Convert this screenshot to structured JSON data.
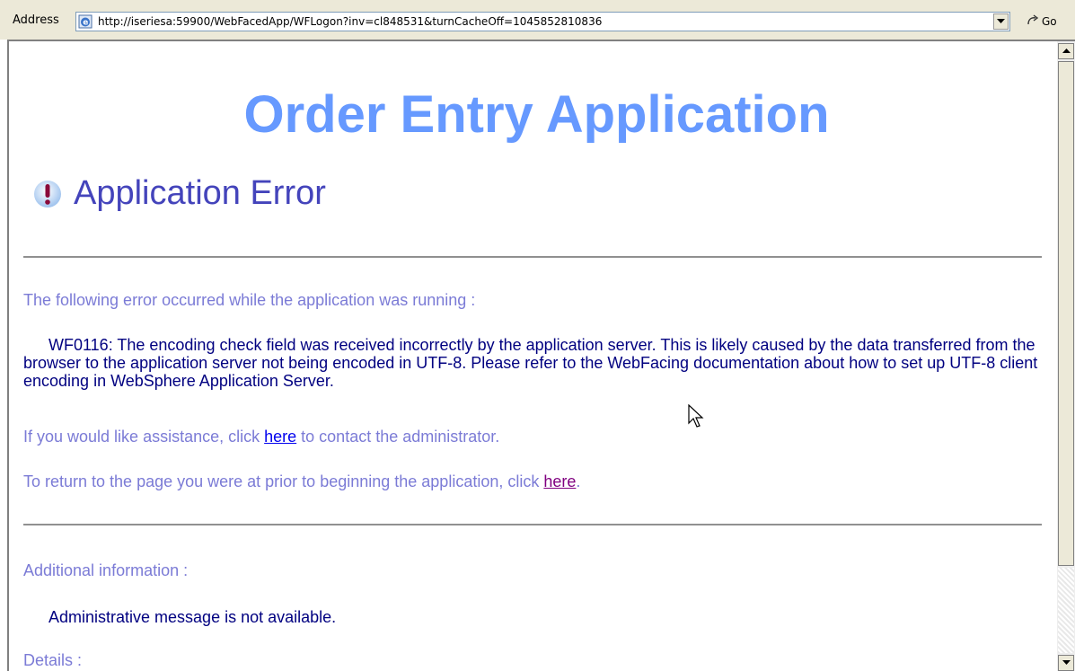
{
  "address_bar": {
    "label": "Address",
    "url": "http://iseriesa:59900/WebFacedApp/WFLogon?inv=cl848531&turnCacheOff=1045852810836",
    "go_label": "Go"
  },
  "page": {
    "app_title": "Order Entry Application",
    "error_title": "Application Error",
    "intro": "The following error occurred while the application was running :",
    "error_message": "WF0116: The encoding check field was received incorrectly by the application server. This is likely caused by the data transferred from the browser to the application server not being encoded in UTF-8. Please refer to the WebFacing documentation about how to set up UTF-8 client encoding in WebSphere Application Server.",
    "assist_prefix": "If you would like assistance, click ",
    "assist_link": "here",
    "assist_suffix": " to contact the administrator.",
    "return_prefix": "To return to the page you were at prior to beginning the application, click ",
    "return_link": "here",
    "return_suffix": ".",
    "additional_label": "Additional information :",
    "admin_message": "Administrative message is not available.",
    "details_label": "Details :"
  },
  "colors": {
    "title": "#6699ff",
    "heading": "#4444bb",
    "label": "#7b7bd6",
    "body": "#000080"
  },
  "icons": {
    "browser": "ie-page-icon",
    "error": "exclamation-icon",
    "go": "go-arrow-icon",
    "pointer": "mouse-pointer-icon"
  }
}
